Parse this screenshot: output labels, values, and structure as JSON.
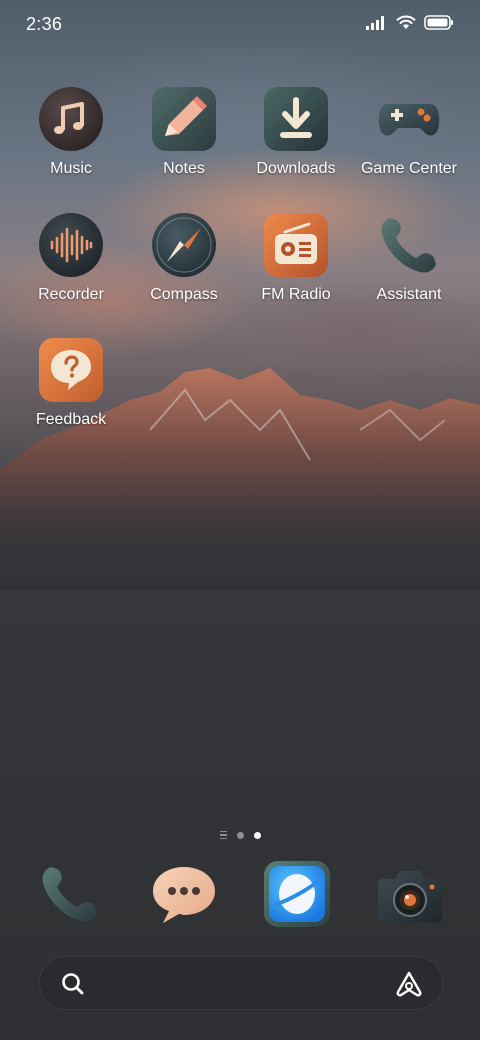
{
  "status_bar": {
    "time": "2:36",
    "signal_icon": "signal-bars-icon",
    "wifi_icon": "wifi-icon",
    "battery_icon": "battery-icon"
  },
  "apps": [
    {
      "label": "Music",
      "icon": "music-note-icon"
    },
    {
      "label": "Notes",
      "icon": "pencil-icon"
    },
    {
      "label": "Downloads",
      "icon": "download-icon"
    },
    {
      "label": "Game Center",
      "icon": "gamepad-icon"
    },
    {
      "label": "Recorder",
      "icon": "waveform-icon"
    },
    {
      "label": "Compass",
      "icon": "compass-icon"
    },
    {
      "label": "FM Radio",
      "icon": "radio-icon"
    },
    {
      "label": "Assistant",
      "icon": "phone-handset-icon"
    },
    {
      "label": "Feedback",
      "icon": "question-bubble-icon"
    }
  ],
  "page_indicator": {
    "pages": 3,
    "current": 3
  },
  "dock": [
    {
      "name": "phone",
      "icon": "phone-icon"
    },
    {
      "name": "messages",
      "icon": "chat-bubble-icon"
    },
    {
      "name": "browser",
      "icon": "browser-planet-icon"
    },
    {
      "name": "camera",
      "icon": "camera-icon"
    }
  ],
  "search": {
    "placeholder": "",
    "value": ""
  },
  "colors": {
    "accent_orange": "#e2773a",
    "icon_stone_teal": "#3f5a57",
    "icon_stone_dark": "#2e3a40",
    "cream": "#f1e3cf"
  }
}
